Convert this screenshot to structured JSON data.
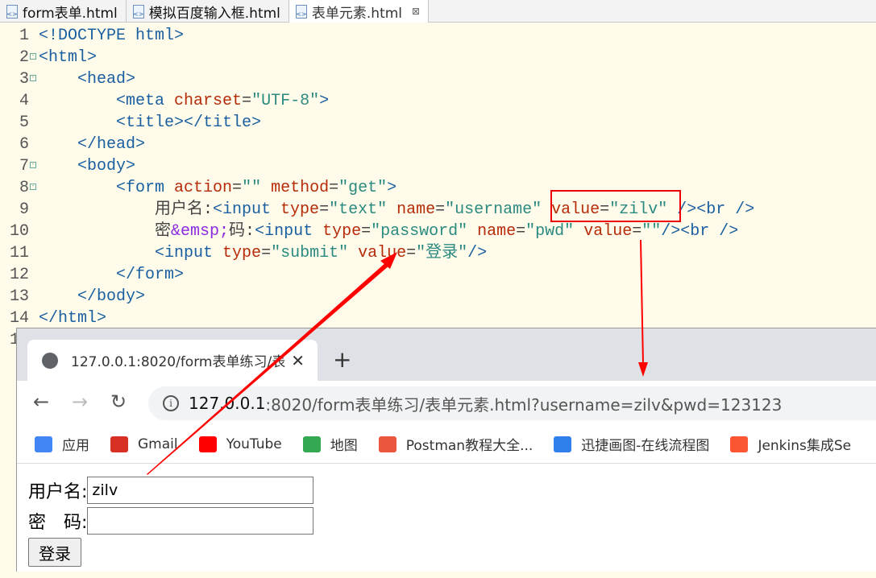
{
  "editor": {
    "tabs": [
      {
        "label": "form表单.html"
      },
      {
        "label": "模拟百度输入框.html"
      },
      {
        "label": "表单元素.html",
        "active": true
      }
    ],
    "close_glyph": "⊠",
    "lines": [
      [
        [
          "doc",
          "<!DOCTYPE html>"
        ]
      ],
      [
        [
          "tag",
          "<html>"
        ]
      ],
      [
        [
          "plain",
          "    "
        ],
        [
          "tag",
          "<head>"
        ]
      ],
      [
        [
          "plain",
          "        "
        ],
        [
          "tag",
          "<meta "
        ],
        [
          "attr",
          "charset"
        ],
        [
          "plain",
          "="
        ],
        [
          "val",
          "\"UTF-8\""
        ],
        [
          "tag",
          ">"
        ]
      ],
      [
        [
          "plain",
          "        "
        ],
        [
          "tag",
          "<title></title>"
        ]
      ],
      [
        [
          "plain",
          "    "
        ],
        [
          "tag",
          "</head>"
        ]
      ],
      [
        [
          "plain",
          "    "
        ],
        [
          "tag",
          "<body>"
        ]
      ],
      [
        [
          "plain",
          "        "
        ],
        [
          "tag",
          "<form "
        ],
        [
          "attr",
          "action"
        ],
        [
          "plain",
          "="
        ],
        [
          "val",
          "\"\" "
        ],
        [
          "attr",
          "method"
        ],
        [
          "plain",
          "="
        ],
        [
          "val",
          "\"get\""
        ],
        [
          "tag",
          ">"
        ]
      ],
      [
        [
          "plain",
          "            用户名:"
        ],
        [
          "tag",
          "<input "
        ],
        [
          "attr",
          "type"
        ],
        [
          "plain",
          "="
        ],
        [
          "val",
          "\"text\" "
        ],
        [
          "attr",
          "name"
        ],
        [
          "plain",
          "="
        ],
        [
          "val",
          "\"username\" "
        ],
        [
          "attr",
          "value"
        ],
        [
          "plain",
          "="
        ],
        [
          "val",
          "\"zilv\" "
        ],
        [
          "tag",
          "/><br />"
        ]
      ],
      [
        [
          "plain",
          "            密"
        ],
        [
          "ent",
          "&emsp;"
        ],
        [
          "plain",
          "码:"
        ],
        [
          "tag",
          "<input "
        ],
        [
          "attr",
          "type"
        ],
        [
          "plain",
          "="
        ],
        [
          "val",
          "\"password\" "
        ],
        [
          "attr",
          "name"
        ],
        [
          "plain",
          "="
        ],
        [
          "val",
          "\"pwd\" "
        ],
        [
          "attr",
          "value"
        ],
        [
          "plain",
          "="
        ],
        [
          "val",
          "\"\""
        ],
        [
          "tag",
          "/><br />"
        ]
      ],
      [
        [
          "plain",
          "            "
        ],
        [
          "tag",
          "<input "
        ],
        [
          "attr",
          "type"
        ],
        [
          "plain",
          "="
        ],
        [
          "val",
          "\"submit\" "
        ],
        [
          "attr",
          "value"
        ],
        [
          "plain",
          "="
        ],
        [
          "val",
          "\"登录\""
        ],
        [
          "tag",
          "/>"
        ]
      ],
      [
        [
          "plain",
          "        "
        ],
        [
          "tag",
          "</form>"
        ]
      ],
      [
        [
          "plain",
          "    "
        ],
        [
          "tag",
          "</body>"
        ]
      ],
      [
        [
          "tag",
          "</html>"
        ]
      ],
      [
        [
          "plain",
          ""
        ]
      ]
    ],
    "folded_lines": [
      2,
      3,
      7,
      8
    ]
  },
  "browser": {
    "tab_title": "127.0.0.1:8020/form表单练习/表",
    "close": "✕",
    "new_tab": "+",
    "back": "←",
    "forward": "→",
    "reload": "↻",
    "url_host": "127.0.0.1",
    "url_rest": ":8020/form表单练习/表单元素.html?username=zilv&pwd=123123",
    "bookmarks": [
      {
        "label": "应用",
        "icon": "apps-grid-icon",
        "color": "#4285f4"
      },
      {
        "label": "Gmail",
        "icon": "gmail-icon",
        "color": "#d93025"
      },
      {
        "label": "YouTube",
        "icon": "youtube-icon",
        "color": "#ff0000"
      },
      {
        "label": "地图",
        "icon": "maps-icon",
        "color": "#34a853"
      },
      {
        "label": "Postman教程大全...",
        "icon": "jianshu-icon",
        "color": "#e9573f"
      },
      {
        "label": "迅捷画图-在线流程图",
        "icon": "xunjie-icon",
        "color": "#2f80ed"
      },
      {
        "label": "Jenkins集成Se",
        "icon": "csdn-icon",
        "color": "#fc5531"
      }
    ]
  },
  "form": {
    "username_label": "用户名:",
    "username_value": "zilv",
    "password_label": "密　码:",
    "password_value": "",
    "submit_label": "登录"
  },
  "annotation_color": "#ff0000"
}
